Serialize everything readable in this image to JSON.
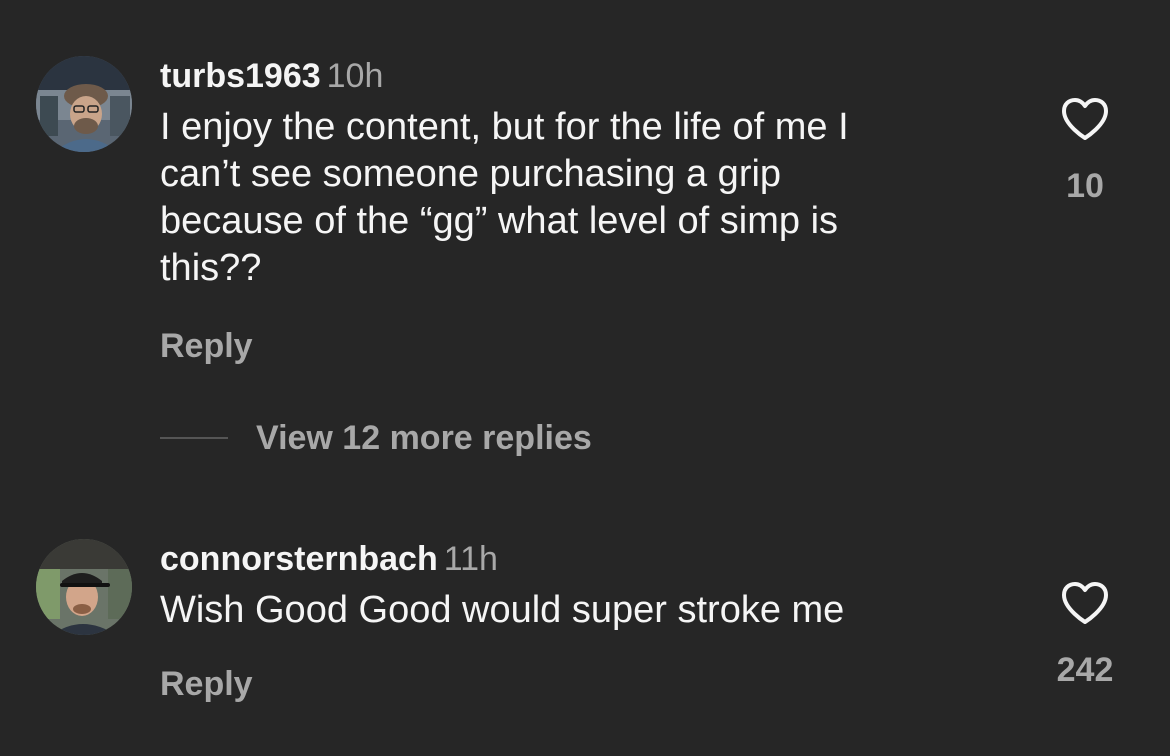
{
  "comments": [
    {
      "username": "turbs1963",
      "time": "10h",
      "text_lines": [
        "I enjoy the content, but for the life of me I",
        "can’t see someone purchasing a grip",
        "because of the “gg” what level of simp is",
        "this??"
      ],
      "reply_label": "Reply",
      "like_count": "10",
      "avatar_icon": "avatar-photo"
    },
    {
      "username": "connorsternbach",
      "time": "11h",
      "text_lines": [
        "Wish Good Good would super stroke me"
      ],
      "reply_label": "Reply",
      "like_count": "242",
      "avatar_icon": "avatar-photo"
    }
  ],
  "thread": {
    "view_replies_label": "View 12 more replies"
  },
  "icons": {
    "like": "heart-outline-icon"
  },
  "colors": {
    "background": "#262626",
    "primary_text": "#f5f5f5",
    "secondary_text": "#a8a8a8"
  }
}
